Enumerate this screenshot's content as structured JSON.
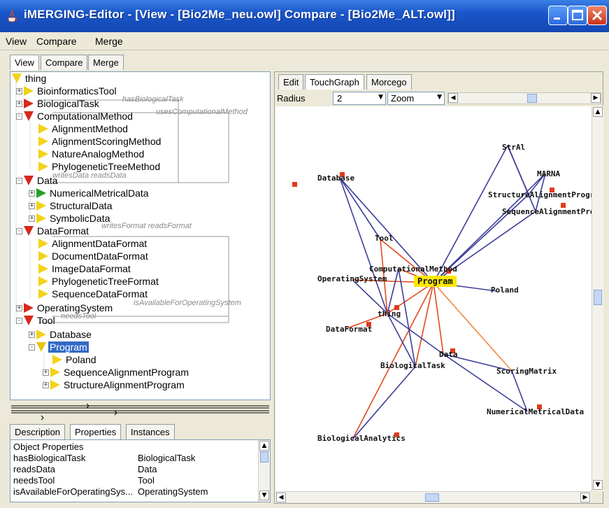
{
  "window": {
    "title": "iMERGING-Editor - [View - [Bio2Me_neu.owl] Compare - [Bio2Me_ALT.owl]]"
  },
  "menubar": {
    "items": [
      "View",
      "Compare",
      "Merge"
    ]
  },
  "main_tabs": [
    "View",
    "Compare",
    "Merge"
  ],
  "tree": {
    "nodes": [
      {
        "label": "thing"
      },
      {
        "label": "BioinformaticsTool"
      },
      {
        "label": "BiologicalTask"
      },
      {
        "label": "ComputationalMethod"
      },
      {
        "label": "AlignmentMethod"
      },
      {
        "label": "AlignmentScoringMethod"
      },
      {
        "label": "NatureAnalogMethod"
      },
      {
        "label": "PhylogeneticTreeMethod"
      },
      {
        "label": "Data"
      },
      {
        "label": "NumericalMetricalData"
      },
      {
        "label": "StructuralData"
      },
      {
        "label": "SymbolicData"
      },
      {
        "label": "DataFormat"
      },
      {
        "label": "AlignmentDataFormat"
      },
      {
        "label": "DocumentDataFormat"
      },
      {
        "label": "ImageDataFormat"
      },
      {
        "label": "PhylogeneticTreeFormat"
      },
      {
        "label": "SequenceDataFormat"
      },
      {
        "label": "OperatingSystem"
      },
      {
        "label": "Tool"
      },
      {
        "label": "Database"
      },
      {
        "label": "Program"
      },
      {
        "label": "Poland"
      },
      {
        "label": "SequenceAlignmentProgram"
      },
      {
        "label": "StructureAlignmentProgram"
      }
    ],
    "relations": [
      "hasBiologicalTask",
      "usesComputationalMethod",
      "writesData readsData",
      "writesFormat readsFormat",
      "isAvailableForOperatingSystem",
      "needsTool"
    ]
  },
  "bottom_tabs": [
    "Description",
    "Properties",
    "Instances"
  ],
  "properties": {
    "header": "Object Properties",
    "rows": [
      {
        "property": "hasBiologicalTask",
        "range": "BiologicalTask"
      },
      {
        "property": "readsData",
        "range": "Data"
      },
      {
        "property": "needsTool",
        "range": "Tool"
      },
      {
        "property": "isAvailableForOperatingSys...",
        "range": "OperatingSystem"
      }
    ]
  },
  "graph_tabs": [
    "Edit",
    "TouchGraph",
    "Morcego"
  ],
  "graph_toolbar": {
    "radius_label": "Radius",
    "radius_value": "2",
    "zoom_label": "Zoom"
  },
  "graph": {
    "center": "Program",
    "labels": [
      "Database",
      "StrAl",
      "MARNA",
      "StructureAlignmentProgram",
      "SequenceAlignmentProgram",
      "Tool",
      "ComputationalMethod",
      "OperatingSystem",
      "Poland",
      "thing",
      "DataFormat",
      "Data",
      "ScoringMatrix",
      "BiologicalTask",
      "NumericalMetricalData",
      "BiologicalAnalytics"
    ]
  },
  "colors": {
    "title_bar": "#1a56c9",
    "selection": "#316ac5",
    "edge_blue": "#3e3e9a",
    "edge_red": "#e24a1e",
    "center_node": "#ffe800"
  }
}
